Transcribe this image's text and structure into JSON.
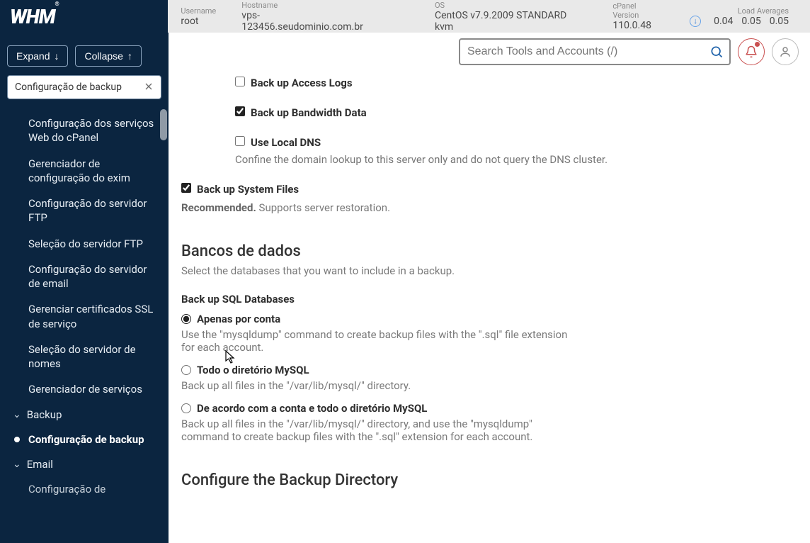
{
  "topbar": {
    "logo": "WHM",
    "username_label": "Username",
    "username_value": "root",
    "hostname_label": "Hostname",
    "hostname_value": "vps-123456.seudominio.com.br",
    "os_label": "OS",
    "os_value": "CentOS v7.9.2009 STANDARD kvm",
    "cpanel_label": "cPanel Version",
    "cpanel_value": "110.0.48",
    "load_label": "Load Averages",
    "load_1": "0.04",
    "load_5": "0.05",
    "load_15": "0.05"
  },
  "search": {
    "placeholder": "Search Tools and Accounts (/)"
  },
  "sidebar": {
    "expand": "Expand",
    "collapse": "Collapse",
    "filter_value": "Configuração de backup",
    "items": [
      {
        "label": "Configuração dos serviços Web do cPanel"
      },
      {
        "label": "Gerenciador de configuração do exim"
      },
      {
        "label": "Configuração do servidor FTP"
      },
      {
        "label": "Seleção do servidor FTP"
      },
      {
        "label": "Configuração do servidor de email"
      },
      {
        "label": "Gerenciar certificados SSL de serviço"
      },
      {
        "label": "Seleção do servidor de nomes"
      },
      {
        "label": "Gerenciador de serviços"
      }
    ],
    "section_backup": "Backup",
    "active_item": "Configuração de backup",
    "section_email": "Email",
    "last_peek": "Configuração de"
  },
  "main": {
    "cb_access_logs": "Back up Access Logs",
    "cb_bandwidth": "Back up Bandwidth Data",
    "cb_local_dns": "Use Local DNS",
    "cb_local_dns_help": "Confine the domain lookup to this server only and do not query the DNS cluster.",
    "cb_sysfiles": "Back up System Files",
    "sysfiles_tip_strong": "Recommended.",
    "sysfiles_tip_rest": " Supports server restoration.",
    "db_heading": "Bancos de dados",
    "db_sub": "Select the databases that you want to include in a backup.",
    "sql_title": "Back up SQL Databases",
    "r1_label": "Apenas por conta",
    "r1_help": "Use the \"mysqldump\" command to create backup files with the \".sql\" file extension for each account.",
    "r2_label": "Todo o diretório MySQL",
    "r2_help": "Back up all files in the \"/var/lib/mysql/\" directory.",
    "r3_label": "De acordo com a conta e todo o diretório MySQL",
    "r3_help": "Back up all files in the \"/var/lib/mysql/\" directory, and use the \"mysqldump\" command to create backup files with the \".sql\" extension for each account.",
    "dir_heading": "Configure the Backup Directory"
  }
}
